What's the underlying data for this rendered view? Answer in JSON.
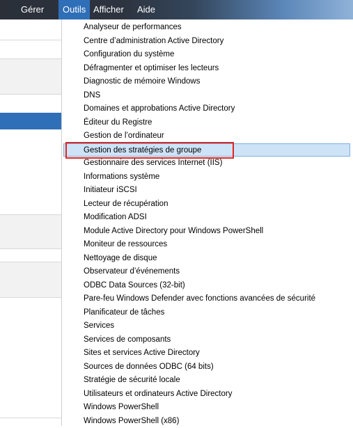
{
  "menubar": {
    "items": [
      {
        "label": "Gérer",
        "active": false
      },
      {
        "label": "Outils",
        "active": true
      },
      {
        "label": "Afficher",
        "active": false
      },
      {
        "label": "Aide",
        "active": false
      }
    ]
  },
  "tools_menu": {
    "items": [
      "Analyseur de performances",
      "Centre d’administration Active Directory",
      "Configuration du système",
      "Défragmenter et optimiser les lecteurs",
      "Diagnostic de mémoire Windows",
      "DNS",
      "Domaines et approbations Active Directory",
      "Éditeur du Registre",
      "Gestion de l’ordinateur",
      "Gestion des stratégies de groupe",
      "Gestionnaire des services Internet (IIS)",
      "Informations système",
      "Initiateur iSCSI",
      "Lecteur de récupération",
      "Modification ADSI",
      "Module Active Directory pour Windows PowerShell",
      "Moniteur de ressources",
      "Nettoyage de disque",
      "Observateur d’événements",
      "ODBC Data Sources (32-bit)",
      "Pare-feu Windows Defender avec fonctions avancées de sécurité",
      "Planificateur de tâches",
      "Services",
      "Services de composants",
      "Sites et services Active Directory",
      "Sources de données ODBC (64 bits)",
      "Stratégie de sécurité locale",
      "Utilisateurs et ordinateurs Active Directory",
      "Windows PowerShell",
      "Windows PowerShell (x86)"
    ],
    "highlighted_index": 9
  },
  "colors": {
    "accent": "#2f6fb7",
    "highlight_bg": "#cfe3f7",
    "annotation_red": "#e0271f"
  }
}
